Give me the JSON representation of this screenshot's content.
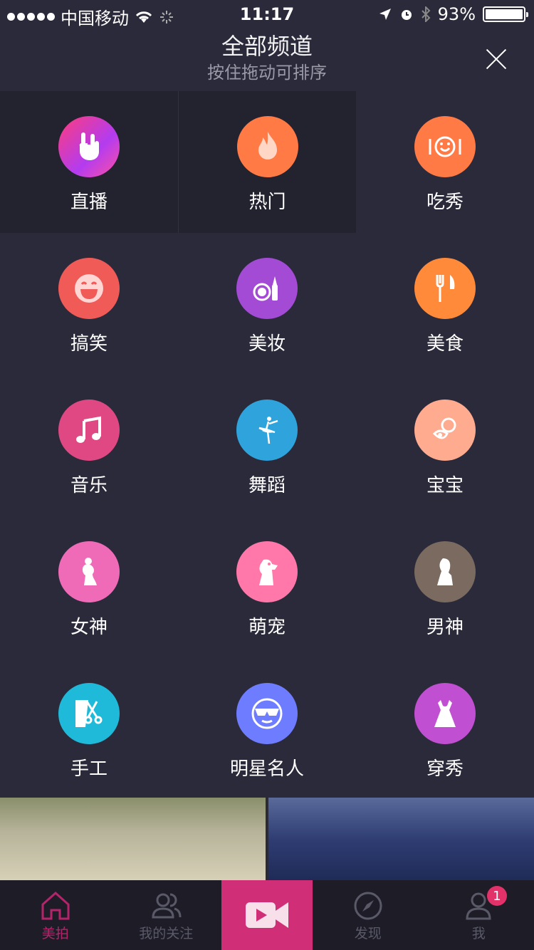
{
  "status_bar": {
    "carrier": "中国移动",
    "time": "11:17",
    "battery": "93%"
  },
  "header": {
    "title": "全部频道",
    "subtitle": "按住拖动可排序"
  },
  "channels": [
    {
      "label": "直播",
      "icon": "rock-hand-icon",
      "color": "#b33cf0"
    },
    {
      "label": "热门",
      "icon": "flame-icon",
      "color": "#ff7a45"
    },
    {
      "label": "吃秀",
      "icon": "dining-face-icon",
      "color": "#ff7a45"
    },
    {
      "label": "搞笑",
      "icon": "laughing-face-icon",
      "color": "#f05a57"
    },
    {
      "label": "美妆",
      "icon": "makeup-icon",
      "color": "#a44bd6"
    },
    {
      "label": "美食",
      "icon": "fork-knife-icon",
      "color": "#ff8a3a"
    },
    {
      "label": "音乐",
      "icon": "music-note-icon",
      "color": "#df4882"
    },
    {
      "label": "舞蹈",
      "icon": "ballerina-icon",
      "color": "#2fa3dc"
    },
    {
      "label": "宝宝",
      "icon": "pacifier-icon",
      "color": "#ffab8f"
    },
    {
      "label": "女神",
      "icon": "woman-silhouette-icon",
      "color": "#ef6bb8"
    },
    {
      "label": "萌宠",
      "icon": "pets-icon",
      "color": "#ff78a9"
    },
    {
      "label": "男神",
      "icon": "man-silhouette-icon",
      "color": "#7a6a60"
    },
    {
      "label": "手工",
      "icon": "scissors-icon",
      "color": "#1fb9d9"
    },
    {
      "label": "明星名人",
      "icon": "sunglasses-face-icon",
      "color": "#6e7dff"
    },
    {
      "label": "穿秀",
      "icon": "dress-icon",
      "color": "#c14fd1"
    }
  ],
  "tabbar": {
    "items": [
      {
        "label": "美拍",
        "icon": "home-icon"
      },
      {
        "label": "我的关注",
        "icon": "people-icon"
      },
      {
        "label": "",
        "icon": "video-camera-icon"
      },
      {
        "label": "发现",
        "icon": "compass-icon"
      },
      {
        "label": "我",
        "icon": "person-icon",
        "badge": "1"
      }
    ]
  }
}
